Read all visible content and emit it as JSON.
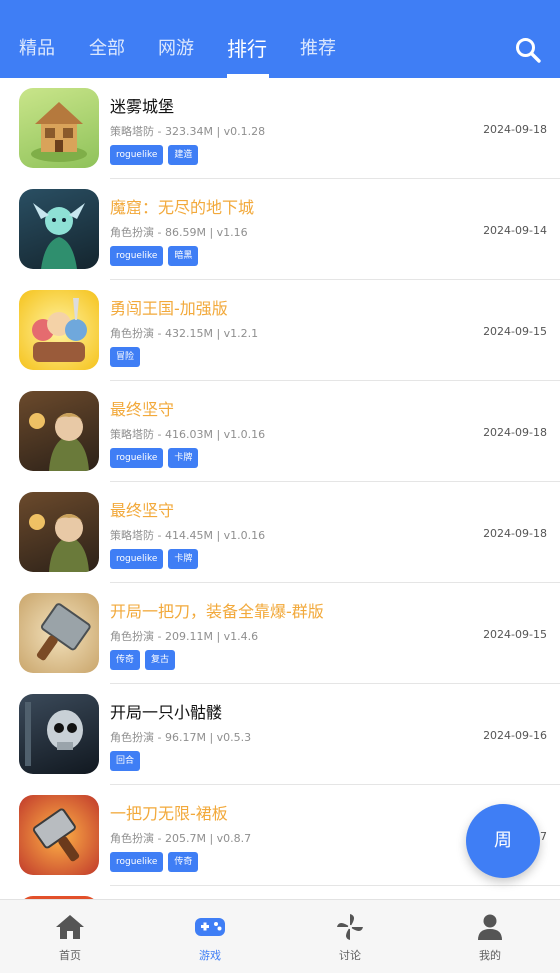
{
  "header": {
    "tabs": [
      {
        "label": "精品"
      },
      {
        "label": "全部"
      },
      {
        "label": "网游"
      },
      {
        "label": "排行"
      },
      {
        "label": "推荐"
      }
    ],
    "active_tab": "排行"
  },
  "games": [
    {
      "title": "迷雾城堡",
      "title_color": "black",
      "meta": "策略塔防 - 323.34M | v0.1.28",
      "date": "2024-09-18",
      "tags": [
        "roguelike",
        "建造"
      ],
      "icon": "castle-game-icon"
    },
    {
      "title": "魔窟：无尽的地下城",
      "title_color": "gold",
      "meta": "角色扮演 - 86.59M | v1.16",
      "date": "2024-09-14",
      "tags": [
        "roguelike",
        "暗黑"
      ],
      "icon": "dungeon-game-icon"
    },
    {
      "title": "勇闯王国-加强版",
      "title_color": "gold",
      "meta": "角色扮演 - 432.15M | v1.2.1",
      "date": "2024-09-15",
      "tags": [
        "冒险"
      ],
      "icon": "kingdom-game-icon"
    },
    {
      "title": "最终坚守",
      "title_color": "gold",
      "meta": "策略塔防 - 416.03M | v1.0.16",
      "date": "2024-09-18",
      "tags": [
        "roguelike",
        "卡牌"
      ],
      "icon": "final-stand-game-icon"
    },
    {
      "title": "最终坚守",
      "title_color": "gold",
      "meta": "策略塔防 - 414.45M | v1.0.16",
      "date": "2024-09-18",
      "tags": [
        "roguelike",
        "卡牌"
      ],
      "icon": "final-stand-game-icon"
    },
    {
      "title": "开局一把刀，装备全靠爆-群版",
      "title_color": "gold",
      "meta": "角色扮演 - 209.11M | v1.4.6",
      "date": "2024-09-15",
      "tags": [
        "传奇",
        "复古"
      ],
      "icon": "cleaver-game-icon"
    },
    {
      "title": "开局一只小骷髅",
      "title_color": "black",
      "meta": "角色扮演 - 96.17M | v0.5.3",
      "date": "2024-09-16",
      "tags": [
        "回合"
      ],
      "icon": "skeleton-game-icon"
    },
    {
      "title": "一把刀无限-裙板",
      "title_color": "gold",
      "meta": "角色扮演 - 205.7M | v0.8.7",
      "date": "2024-09-17",
      "tags": [
        "roguelike",
        "传奇"
      ],
      "icon": "flaming-blade-game-icon"
    }
  ],
  "fab": {
    "label": "周"
  },
  "bottom_nav": [
    {
      "label": "首页",
      "icon": "home-icon"
    },
    {
      "label": "游戏",
      "icon": "gamepad-icon"
    },
    {
      "label": "讨论",
      "icon": "pinwheel-icon"
    },
    {
      "label": "我的",
      "icon": "user-icon"
    }
  ],
  "active_nav": "游戏",
  "colors": {
    "brand": "#3f7ef5",
    "title_gold": "#f2a93b",
    "title_black": "#111111",
    "meta_gray": "#8f8f8f"
  }
}
